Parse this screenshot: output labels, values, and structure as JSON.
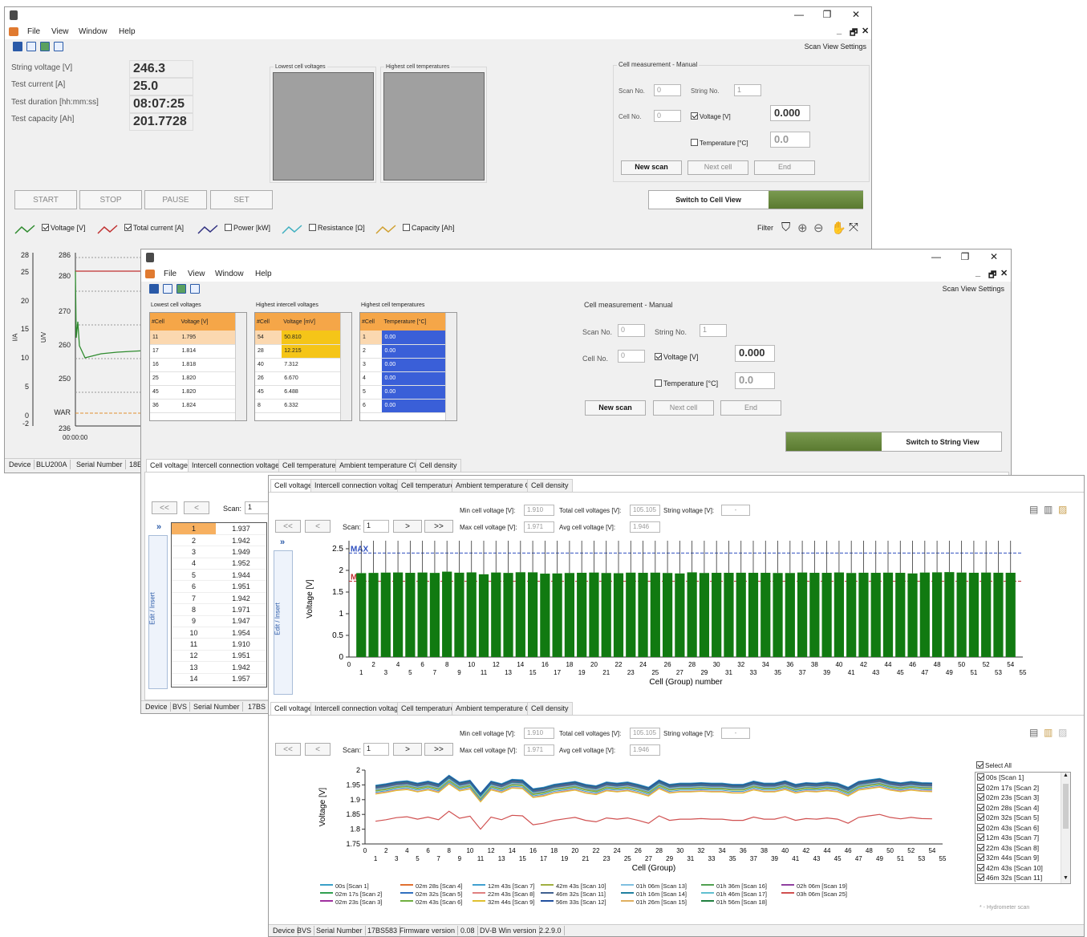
{
  "win1": {
    "menu": [
      "File",
      "View",
      "Window",
      "Help"
    ],
    "scan_view_settings": "Scan View Settings",
    "metrics": [
      {
        "label": "String voltage [V]",
        "value": "246.3"
      },
      {
        "label": "Test current [A]",
        "value": "25.0"
      },
      {
        "label": "Test duration [hh:mm:ss]",
        "value": "08:07:25"
      },
      {
        "label": "Test capacity [Ah]",
        "value": "201.7728"
      }
    ],
    "lowest_cell_voltages": "Lowest cell voltages",
    "highest_cell_temperatures": "Highest cell temperatures",
    "cell_measurement": "Cell measurement - Manual",
    "scan_no_label": "Scan No.",
    "scan_no_value": "0",
    "string_no_label": "String No.",
    "string_no_value": "1",
    "cell_no_label": "Cell No.",
    "cell_no_value": "0",
    "voltage_label": "Voltage [V]",
    "voltage_value": "0.000",
    "temperature_label": "Temperature [°C]",
    "temperature_value": "0.0",
    "new_scan": "New scan",
    "next_cell": "Next cell",
    "end": "End",
    "switch_view": "Switch to Cell View",
    "controls": [
      "START",
      "STOP",
      "PAUSE",
      "SET"
    ],
    "legend": [
      {
        "label": "Voltage [V]",
        "checked": true,
        "color": "#2e8b2e"
      },
      {
        "label": "Total current [A]",
        "checked": true,
        "color": "#c03030"
      },
      {
        "label": "Power [kW]",
        "checked": false,
        "color": "#303080"
      },
      {
        "label": "Resistance [Ω]",
        "checked": false,
        "color": "#40b0c0"
      },
      {
        "label": "Capacity [Ah]",
        "checked": false,
        "color": "#d0a030"
      }
    ],
    "filter": "Filter",
    "ia_ticks": [
      "28",
      "25",
      "20",
      "15",
      "10",
      "5",
      "0",
      "-2"
    ],
    "uv_ticks": [
      "286",
      "280",
      "270",
      "260",
      "250",
      "WAR",
      "236"
    ],
    "ia_axis": "I/A",
    "uv_axis": "U/V",
    "time_tick": "00:00:00",
    "status": [
      "Device",
      "BLU200A",
      "Serial Number",
      "18E"
    ]
  },
  "win2": {
    "menu": [
      "File",
      "View",
      "Window",
      "Help"
    ],
    "scan_view_settings": "Scan View Settings",
    "lowest_title": "Lowest cell voltages",
    "lowest_headers": [
      "#Cell",
      "Voltage [V]"
    ],
    "lowest_rows": [
      [
        "11",
        "1.795"
      ],
      [
        "17",
        "1.814"
      ],
      [
        "16",
        "1.818"
      ],
      [
        "25",
        "1.820"
      ],
      [
        "45",
        "1.820"
      ],
      [
        "36",
        "1.824"
      ]
    ],
    "intercell_title": "Highest intercell voltages",
    "intercell_headers": [
      "#Cell",
      "Voltage [mV]"
    ],
    "intercell_rows": [
      [
        "54",
        "50.810"
      ],
      [
        "28",
        "12.215"
      ],
      [
        "40",
        "7.312"
      ],
      [
        "26",
        "6.670"
      ],
      [
        "45",
        "6.488"
      ],
      [
        "8",
        "6.332"
      ]
    ],
    "temp_title": "Highest cell temperatures",
    "temp_headers": [
      "#Cell",
      "Temperature [°C]"
    ],
    "temp_rows": [
      [
        "1",
        "0.00"
      ],
      [
        "2",
        "0.00"
      ],
      [
        "3",
        "0.00"
      ],
      [
        "4",
        "0.00"
      ],
      [
        "5",
        "0.00"
      ],
      [
        "6",
        "0.00"
      ]
    ],
    "cell_measurement": "Cell measurement - Manual",
    "scan_no_label": "Scan No.",
    "scan_no_value": "0",
    "string_no_label": "String No.",
    "string_no_value": "1",
    "cell_no_label": "Cell No.",
    "cell_no_value": "0",
    "voltage_label": "Voltage [V]",
    "voltage_value": "0.000",
    "temperature_label": "Temperature [°C]",
    "temperature_value": "0.0",
    "new_scan": "New scan",
    "next_cell": "Next cell",
    "end": "End",
    "switch_view": "Switch to String View",
    "tabs": [
      "Cell voltage",
      "Intercell connection voltage",
      "Cell temperature",
      "Ambient temperature CU",
      "Cell density"
    ],
    "nav_first": "<<",
    "nav_prev": "<",
    "scan_label": "Scan:",
    "scan_value": "1",
    "expand": "»",
    "edit_insert": "Edit / Insert",
    "list": [
      [
        "1",
        "1.937"
      ],
      [
        "2",
        "1.942"
      ],
      [
        "3",
        "1.949"
      ],
      [
        "4",
        "1.952"
      ],
      [
        "5",
        "1.944"
      ],
      [
        "6",
        "1.951"
      ],
      [
        "7",
        "1.942"
      ],
      [
        "8",
        "1.971"
      ],
      [
        "9",
        "1.947"
      ],
      [
        "10",
        "1.954"
      ],
      [
        "11",
        "1.910"
      ],
      [
        "12",
        "1.951"
      ],
      [
        "13",
        "1.942"
      ],
      [
        "14",
        "1.957"
      ]
    ],
    "status": [
      "Device",
      "BVS",
      "Serial Number",
      "17BS"
    ]
  },
  "win3": {
    "tabs": [
      "Cell voltage",
      "Intercell connection voltage",
      "Cell temperature",
      "Ambient temperature CU",
      "Cell density"
    ],
    "min_label": "Min cell voltage [V]:",
    "min_value": "1.910",
    "max_label": "Max cell voltage [V]:",
    "max_value": "1.971",
    "total_label": "Total cell voltages [V]:",
    "total_value": "105.105",
    "avg_label": "Avg cell voltage [V]:",
    "avg_value": "1.946",
    "string_label": "String voltage [V]:",
    "string_value": "-",
    "nav": [
      "<<",
      "<",
      ">",
      ">>"
    ],
    "scan_label": "Scan:",
    "scan_value": "1",
    "expand": "»",
    "edit_insert": "Edit / Insert",
    "select_all": "Select All",
    "hydrometer": "* - Hydrometer scan",
    "status": [
      "Device",
      "BVS",
      "Serial Number",
      "17BS583",
      "Firmware version",
      "0.08",
      "DV-B Win version",
      "2.2.9.0"
    ],
    "scan_list": [
      "00s [Scan 1]",
      "02m 17s [Scan 2]",
      "02m 23s [Scan 3]",
      "02m 28s [Scan 4]",
      "02m 32s [Scan 5]",
      "02m 43s [Scan 6]",
      "12m 43s [Scan 7]",
      "22m 43s [Scan 8]",
      "32m 44s [Scan 9]",
      "42m 43s [Scan 10]",
      "46m 32s [Scan 11]"
    ],
    "legend": [
      {
        "label": "00s [Scan 1]",
        "color": "#3aa0c8"
      },
      {
        "label": "02m 17s [Scan 2]",
        "color": "#30a050"
      },
      {
        "label": "02m 23s [Scan 3]",
        "color": "#a030a0"
      },
      {
        "label": "02m 28s [Scan 4]",
        "color": "#e07030"
      },
      {
        "label": "02m 32s [Scan 5]",
        "color": "#3070c0"
      },
      {
        "label": "02m 43s [Scan 6]",
        "color": "#70b040"
      },
      {
        "label": "12m 43s [Scan 7]",
        "color": "#40a0d0"
      },
      {
        "label": "22m 43s [Scan 8]",
        "color": "#e08080"
      },
      {
        "label": "32m 44s [Scan 9]",
        "color": "#e0c030"
      },
      {
        "label": "42m 43s [Scan 10]",
        "color": "#a0b040"
      },
      {
        "label": "46m 32s [Scan 11]",
        "color": "#406090"
      },
      {
        "label": "56m 33s [Scan 12]",
        "color": "#2050a0"
      },
      {
        "label": "01h 06m [Scan 13]",
        "color": "#80c0e0"
      },
      {
        "label": "01h 16m [Scan 14]",
        "color": "#2080a0"
      },
      {
        "label": "01h 26m [Scan 15]",
        "color": "#e0b060"
      },
      {
        "label": "01h 36m [Scan 16]",
        "color": "#50a050"
      },
      {
        "label": "01h 46m [Scan 17]",
        "color": "#60c0d0"
      },
      {
        "label": "01h 56m [Scan 18]",
        "color": "#208040"
      },
      {
        "label": "02h 06m [Scan 19]",
        "color": "#9040a0"
      },
      {
        "label": "03h 06m [Scan 25]",
        "color": "#d05050"
      }
    ]
  },
  "chart_data": [
    {
      "type": "bar",
      "xlabel": "Cell (Group) number",
      "ylabel": "Voltage [V]",
      "ylim": [
        0,
        2.5
      ],
      "yticks": [
        0,
        0.5,
        1,
        1.5,
        2,
        2.5
      ],
      "reference_lines": [
        {
          "label": "MAX",
          "value": 2.4,
          "color": "#3050c0"
        },
        {
          "label": "MIN",
          "value": 1.75,
          "color": "#c03030"
        }
      ],
      "categories": [
        1,
        2,
        3,
        4,
        5,
        6,
        7,
        8,
        9,
        10,
        11,
        12,
        13,
        14,
        15,
        16,
        17,
        18,
        19,
        20,
        21,
        22,
        23,
        24,
        25,
        26,
        27,
        28,
        29,
        30,
        31,
        32,
        33,
        34,
        35,
        36,
        37,
        38,
        39,
        40,
        41,
        42,
        43,
        44,
        45,
        46,
        47,
        48,
        49,
        50,
        51,
        52,
        53,
        54
      ],
      "values": [
        1.937,
        1.942,
        1.949,
        1.952,
        1.944,
        1.951,
        1.942,
        1.971,
        1.947,
        1.954,
        1.91,
        1.951,
        1.942,
        1.957,
        1.955,
        1.925,
        1.93,
        1.94,
        1.945,
        1.95,
        1.94,
        1.935,
        1.948,
        1.944,
        1.948,
        1.94,
        1.93,
        1.955,
        1.94,
        1.944,
        1.944,
        1.946,
        1.944,
        1.944,
        1.94,
        1.94,
        1.951,
        1.944,
        1.944,
        1.952,
        1.94,
        1.946,
        1.944,
        1.948,
        1.944,
        1.93,
        1.95,
        1.955,
        1.96,
        1.95,
        1.945,
        1.95,
        1.946,
        1.945
      ],
      "bar_color": "#117a11"
    },
    {
      "type": "line",
      "xlabel": "Cell (Group)",
      "ylabel": "Voltage [V]",
      "ylim": [
        1.75,
        2.0
      ],
      "yticks": [
        1.75,
        1.8,
        1.85,
        1.9,
        1.95,
        2.0
      ],
      "x": [
        1,
        2,
        3,
        4,
        5,
        6,
        7,
        8,
        9,
        10,
        11,
        12,
        13,
        14,
        15,
        16,
        17,
        18,
        19,
        20,
        21,
        22,
        23,
        24,
        25,
        26,
        27,
        28,
        29,
        30,
        31,
        32,
        33,
        34,
        35,
        36,
        37,
        38,
        39,
        40,
        41,
        42,
        43,
        44,
        45,
        46,
        47,
        48,
        49,
        50,
        51,
        52,
        53,
        54
      ],
      "base_values": [
        1.937,
        1.942,
        1.949,
        1.952,
        1.944,
        1.951,
        1.942,
        1.971,
        1.947,
        1.954,
        1.91,
        1.951,
        1.942,
        1.957,
        1.955,
        1.925,
        1.93,
        1.94,
        1.945,
        1.95,
        1.94,
        1.935,
        1.948,
        1.944,
        1.948,
        1.94,
        1.93,
        1.955,
        1.94,
        1.944,
        1.944,
        1.946,
        1.944,
        1.944,
        1.94,
        1.94,
        1.951,
        1.944,
        1.944,
        1.952,
        1.94,
        1.946,
        1.944,
        1.948,
        1.944,
        1.93,
        1.95,
        1.955,
        1.96,
        1.95,
        1.945,
        1.95,
        1.946,
        1.945
      ],
      "lowest_series": {
        "name": "03h 06m [Scan 25]",
        "offset": -0.11
      }
    }
  ]
}
